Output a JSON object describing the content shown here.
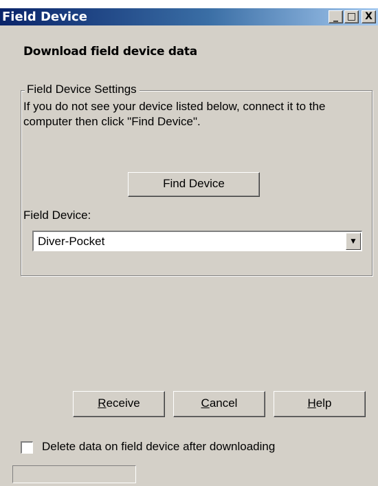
{
  "window": {
    "title": "Field Device",
    "controls": {
      "minimize": "_",
      "maximize": "□",
      "close": "X"
    }
  },
  "heading": "Download field device data",
  "settings_group": {
    "legend": "Field Device Settings",
    "description": "If you do not see your device listed below, connect it to the computer then click \"Find Device\".",
    "find_button": "Find Device",
    "field_device_label": "Field Device:",
    "selected_device": "Diver-Pocket"
  },
  "buttons": {
    "receive": {
      "pre": "",
      "accel": "R",
      "post": "eceive"
    },
    "cancel": {
      "pre": "",
      "accel": "C",
      "post": "ancel"
    },
    "help": {
      "pre": "",
      "accel": "H",
      "post": "elp"
    }
  },
  "delete_option": {
    "label": "Delete data on field device after downloading",
    "checked": false
  },
  "statusbar": {
    "text": ""
  },
  "icons": {
    "dropdown": "chevron-down-icon"
  },
  "colors": {
    "title_start": "#0a246a",
    "title_end": "#a6caf0",
    "face": "#d4d0c8"
  }
}
